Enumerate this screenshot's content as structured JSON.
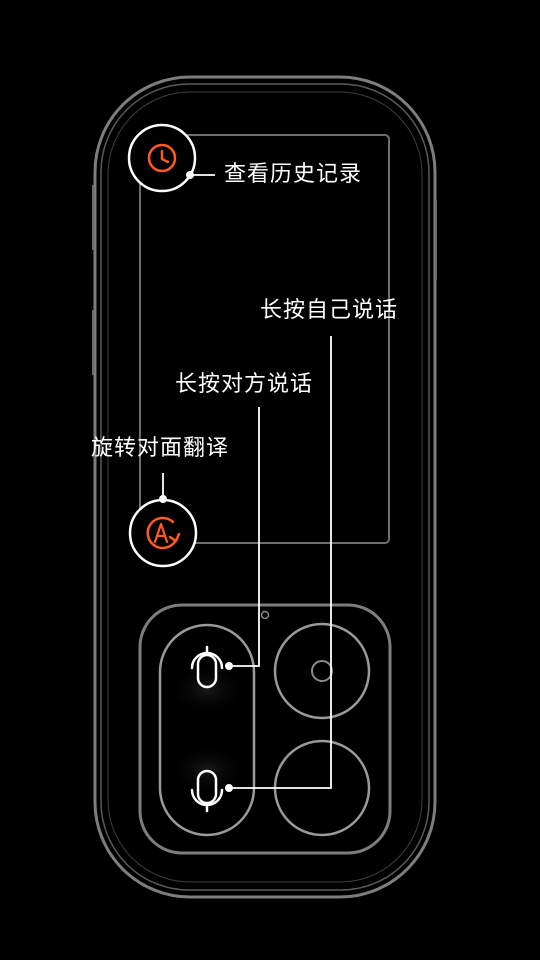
{
  "callouts": {
    "history": "查看历史记录",
    "self_speak": "长按自己说话",
    "other_speak": "长按对方说话",
    "rotate": "旋转对面翻译"
  },
  "icons": {
    "history": "clock-icon",
    "rotate": "rotate-translate-icon",
    "mic_other": "microphone-flipped-icon",
    "mic_self": "microphone-icon"
  },
  "colors": {
    "accent": "#ff5a1f",
    "outline": "#ffffff",
    "device_line": "#8a8a8a",
    "background": "#000000"
  }
}
